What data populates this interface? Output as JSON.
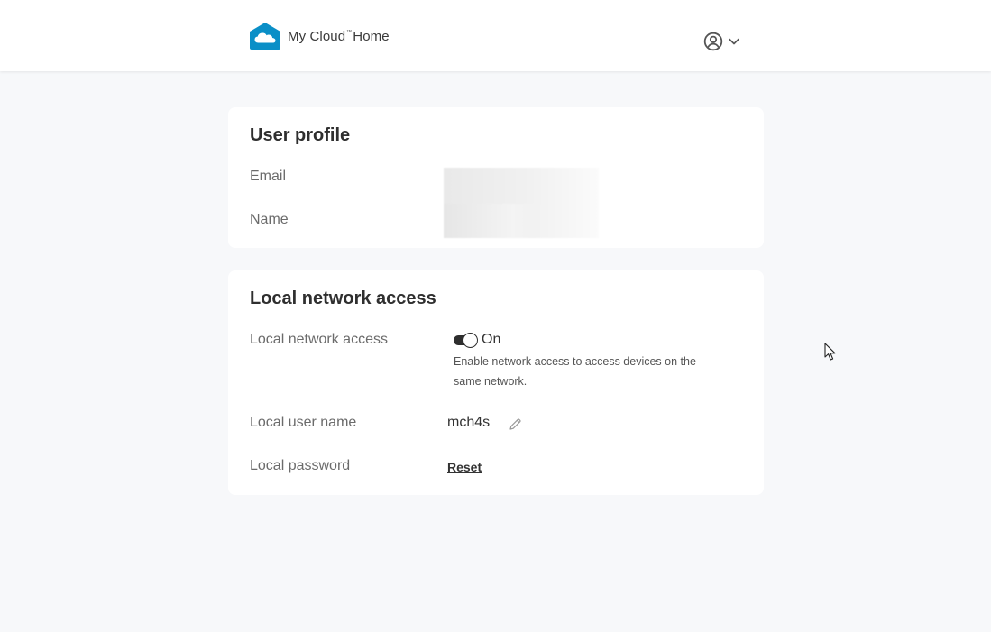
{
  "header": {
    "brand_part1": "My Cloud",
    "brand_sup": "™",
    "brand_part2": "Home",
    "logo_icon": "cloud-home-icon",
    "account_icon": "user-circle-icon",
    "account_chevron_icon": "chevron-down-icon"
  },
  "user_profile": {
    "title": "User profile",
    "email_label": "Email",
    "name_label": "Name"
  },
  "local_network": {
    "title": "Local network access",
    "access_label": "Local network access",
    "toggle_state": "On",
    "toggle_on": true,
    "help_text": "Enable network access to access devices on the same network.",
    "username_label": "Local user name",
    "username_value": "mch4s",
    "edit_icon": "pencil-icon",
    "password_label": "Local password",
    "reset_label": "Reset"
  },
  "colors": {
    "brand": "#0a8fc7",
    "background": "#f7f8fa",
    "card": "#ffffff",
    "text": "#333333",
    "label": "#6b6b6b"
  }
}
